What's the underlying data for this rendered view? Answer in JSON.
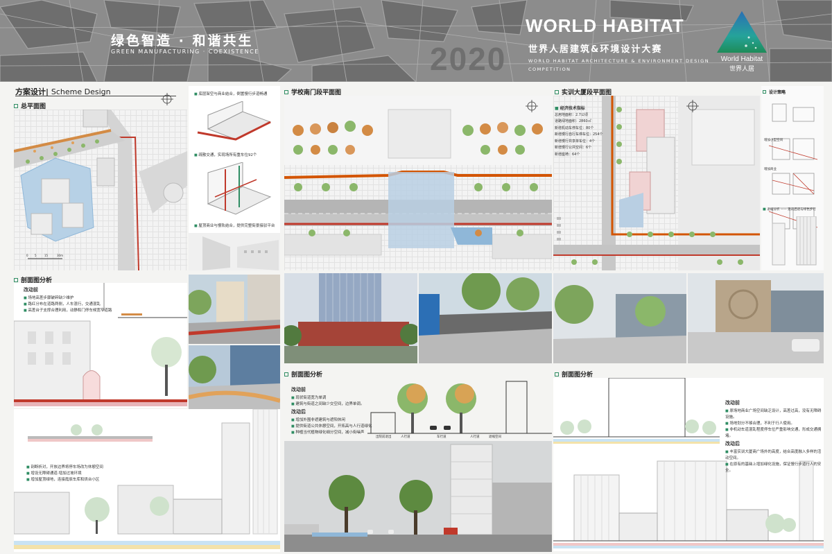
{
  "header": {
    "title_cn": "绿色智造 · 和谐共生",
    "title_en": "GREEN MANUFACTURING · COEXISTENCE",
    "year_watermark": "2020",
    "competition_title": "WORLD HABITAT",
    "competition_cn": "世界人居建筑&环境设计大赛",
    "competition_en": "WORLD HABITAT ARCHITECTURE & ENVIRONMENT DESIGN COMPETITION",
    "logo_text": "World Habitat",
    "logo_cn": "世界人居"
  },
  "scheme": {
    "title_cn": "方案设计|",
    "title_en": "Scheme Design"
  },
  "sections": {
    "master_plan": "总平面图",
    "school_south": "学校南门段平面图",
    "training_building": "实训大厦段平面图",
    "section_left": "剖面图分析",
    "section_mid": "剖面图分析",
    "section_right": "剖面图分析",
    "design_strategy": "设计策略"
  },
  "master_notes": [
    "底层架空与商业结合，倒置慢行步道畅通",
    "疏散交通，实现场所有重车位92个",
    "屋顶商业与慢轨结合，提供完整街景接驳平台"
  ],
  "stats": {
    "heading": "经济技术指标",
    "rows": [
      "总用地面积：2.7公顷",
      "道路绿地面积：2860㎡",
      "新增机动车停车位：80个",
      "新增慢行自行车停车位：254个",
      "新增慢行共享单车位：4个",
      "新增慢行公共空间：6个",
      "新增座椅：64个"
    ]
  },
  "strategy_notes": [
    "增加小型空间",
    "增加商业",
    "退缩分析 —— 建筑后退与绿色步行"
  ],
  "left_section": {
    "before_heading": "改动前",
    "before": [
      "场地高差步骤破碎缺少维护",
      "路红分布在道路两侧，人车混行，交通混乱",
      "高差台子支撑合理利用，动静和门停车候宽窄道路"
    ],
    "after": [
      "剖断析对，开放边界将停车场改为休憩空间",
      "增设无障碍通道·增加过坡环境",
      "增加屋顶绿地，连接霞辰车库和烘台小区"
    ]
  },
  "mid_section": {
    "before_heading": "改动前",
    "before": [
      "现状街道宽为单调",
      "建筑与街道之间缺少交空间，边界单调。"
    ],
    "after_heading": "改动后",
    "after": [
      "增加外围非遮建筑与遮阳休闲",
      "提供街道公共休憩空间，开拓高与人行道绿化",
      "种植当代植物绿化细分空间，减小街噪声"
    ],
    "labels": [
      "出院前退出",
      "人行道",
      "车行道",
      "人行道",
      "退缩空间"
    ]
  },
  "right_section": {
    "before_heading": "改动前",
    "before": [
      "原场地商业广场空间缺乏设计，高差过高，没有无障碍设施。",
      "场地划分不够合理，不利于行人使用。",
      "非机动车道混乱程度停车位严重影响交通，形成交通拥堵。"
    ],
    "after_heading": "改动后",
    "after": [
      "丰富实训大厦商广场外的高度，结合高度融入多样的活动空间。",
      "在原有的基础上增加绿化设施，保证慢行步道行人的安全。"
    ]
  },
  "scale_labels": [
    "0",
    "5",
    "15",
    "30m"
  ],
  "colors": {
    "accent_green": "#2f8d63",
    "header_gray": "#8a8a8a",
    "road_red": "#c0392b",
    "paving_blue": "#8fb7d8",
    "tree_orange": "#d38b45",
    "tree_green": "#7fae5b"
  }
}
